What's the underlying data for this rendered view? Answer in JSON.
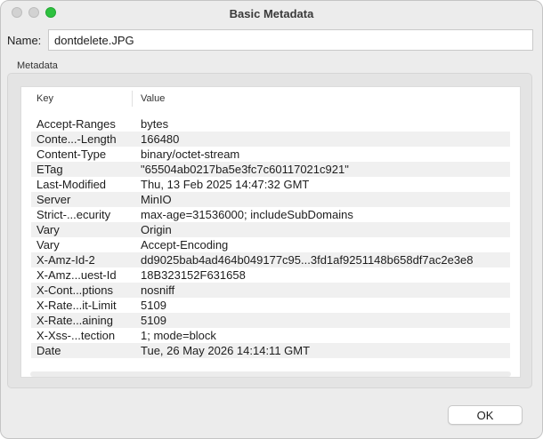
{
  "window": {
    "title": "Basic Metadata"
  },
  "name": {
    "label": "Name:",
    "value": "dontdelete.JPG"
  },
  "group": {
    "label": "Metadata"
  },
  "table": {
    "columns": {
      "key": "Key",
      "value": "Value"
    },
    "rows": [
      {
        "key": "Accept-Ranges",
        "value": "bytes"
      },
      {
        "key": "Conte...-Length",
        "value": "166480"
      },
      {
        "key": "Content-Type",
        "value": "binary/octet-stream"
      },
      {
        "key": "ETag",
        "value": "\"65504ab0217ba5e3fc7c60117021c921\""
      },
      {
        "key": "Last-Modified",
        "value": "Thu, 13 Feb 2025 14:47:32 GMT"
      },
      {
        "key": "Server",
        "value": "MinIO"
      },
      {
        "key": "Strict-...ecurity",
        "value": "max-age=31536000; includeSubDomains"
      },
      {
        "key": "Vary",
        "value": "Origin"
      },
      {
        "key": "Vary",
        "value": "Accept-Encoding"
      },
      {
        "key": "X-Amz-Id-2",
        "value": "dd9025bab4ad464b049177c95...3fd1af9251148b658df7ac2e3e8"
      },
      {
        "key": "X-Amz...uest-Id",
        "value": "18B323152F631658"
      },
      {
        "key": "X-Cont...ptions",
        "value": "nosniff"
      },
      {
        "key": "X-Rate...it-Limit",
        "value": "5109"
      },
      {
        "key": "X-Rate...aining",
        "value": "5109"
      },
      {
        "key": "X-Xss-...tection",
        "value": "1; mode=block"
      },
      {
        "key": "Date",
        "value": "Tue, 26 May 2026 14:14:11 GMT"
      }
    ]
  },
  "buttons": {
    "ok": "OK"
  }
}
